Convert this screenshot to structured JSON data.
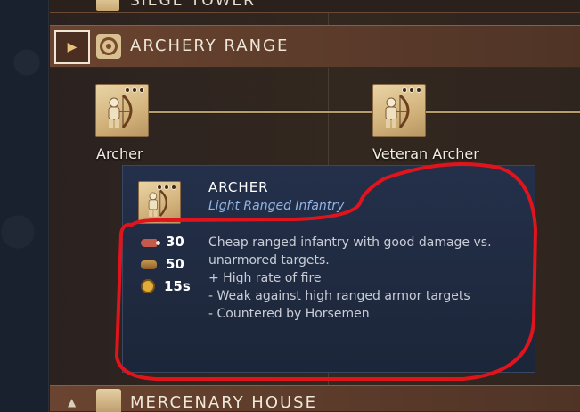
{
  "top_section": {
    "label": "SIEGE TOWER"
  },
  "archery_section": {
    "title": "ARCHERY RANGE",
    "units": [
      {
        "name": "Archer"
      },
      {
        "name": "Veteran Archer"
      }
    ]
  },
  "merc_section": {
    "title": "MERCENARY HOUSE"
  },
  "tooltip": {
    "name": "ARCHER",
    "unit_class": "Light Ranged Infantry",
    "costs": {
      "food": "30",
      "wood": "50",
      "time": "15s"
    },
    "description": [
      "Cheap ranged infantry with good damage vs.",
      "unarmored targets.",
      "+ High rate of fire",
      "- Weak against high ranged armor targets",
      "- Countered by Horsemen"
    ]
  },
  "icons": {
    "expand": "chevron-right-icon",
    "section": "target-icon",
    "collapse": "chevron-up-icon"
  },
  "colors": {
    "section_bar": "#6a4430",
    "tooltip_bg": "#24304a",
    "unit_class": "#8fb4e6",
    "annotation": "#e0141c"
  }
}
